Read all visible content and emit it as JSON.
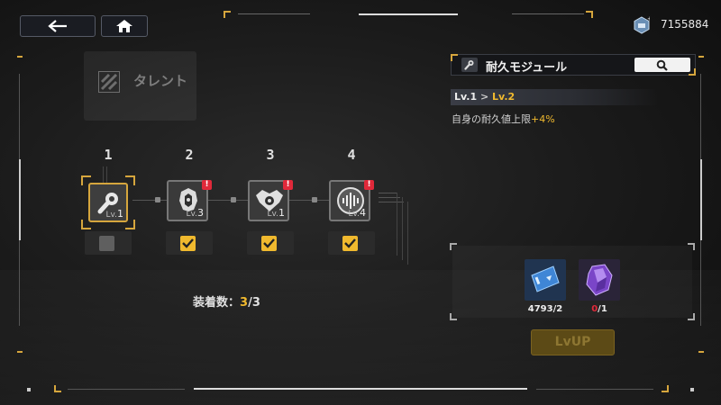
{
  "header": {
    "currency_amount": "7155884",
    "icons": {
      "back": "back-arrow-icon",
      "home": "home-icon",
      "currency": "cube-currency-icon"
    }
  },
  "talent": {
    "label": "タレント",
    "icon": "stripes-icon"
  },
  "slots": [
    {
      "number": "1",
      "icon": "wrench-icon",
      "lv_prefix": "Lv.",
      "level": "1",
      "selected": true,
      "alert": false,
      "equipped": false
    },
    {
      "number": "2",
      "icon": "armor-icon",
      "lv_prefix": "Lv.",
      "level": "3",
      "selected": false,
      "alert": true,
      "equipped": true
    },
    {
      "number": "3",
      "icon": "wings-emblem-icon",
      "lv_prefix": "Lv.",
      "level": "1",
      "selected": false,
      "alert": true,
      "equipped": true
    },
    {
      "number": "4",
      "icon": "equalizer-icon",
      "lv_prefix": "Lv.",
      "level": "4",
      "selected": false,
      "alert": true,
      "equipped": true
    }
  ],
  "alert_mark": "!",
  "equip_count": {
    "label": "装着数：",
    "current": "3",
    "separator": "/",
    "max": "3"
  },
  "detail": {
    "title": "耐久モジュール",
    "title_icon": "wrench-icon",
    "search_icon": "magnifier-icon",
    "level_from": "Lv.1",
    "arrow": ">",
    "level_to": "Lv.2",
    "effect_text": "自身の耐久値上限",
    "effect_value": "+4%"
  },
  "materials": [
    {
      "icon": "blue-ticket-icon",
      "owned": "4793",
      "sep": "/",
      "required": "2",
      "sufficient": true
    },
    {
      "icon": "purple-crystal-icon",
      "owned": "0",
      "sep": "/",
      "required": "1",
      "sufficient": false
    }
  ],
  "lvup_label": "LvUP",
  "colors": {
    "accent": "#f0b92e",
    "alert": "#e0293a",
    "insufficient": "#e0293a",
    "lvup_disabled": "#5c4a16"
  }
}
